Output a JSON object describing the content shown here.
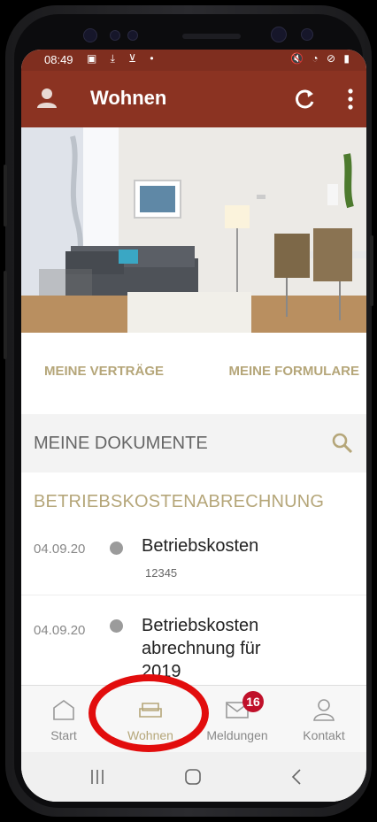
{
  "status_bar": {
    "time": "08:49",
    "left_icons": "▣ ⤓ ⊻ •",
    "right_icons": "🔇 ◔ ⊘ ▮"
  },
  "app_bar": {
    "title": "Wohnen",
    "icons": [
      "user-icon",
      "refresh-icon",
      "more-vert-icon"
    ]
  },
  "tabs": [
    {
      "label": "MEINE VERTRÄGE"
    },
    {
      "label": "MEINE FORMULARE"
    }
  ],
  "documents_header": {
    "label": "MEINE DOKUMENTE",
    "icon": "search-icon"
  },
  "category": "BETRIEBSKOSTENABRECHNUNG",
  "documents": [
    {
      "date": "04.09.20",
      "title": "Betriebskosten",
      "subtitle": "12345"
    },
    {
      "date": "04.09.20",
      "title": "Betriebskosten abrechnung für 2019",
      "subtitle": ""
    }
  ],
  "bottom_nav": [
    {
      "label": "Start",
      "icon": "home-outline-icon",
      "active": false
    },
    {
      "label": "Wohnen",
      "icon": "sofa-icon",
      "active": true
    },
    {
      "label": "Meldungen",
      "icon": "mail-icon",
      "active": false,
      "badge": "16"
    },
    {
      "label": "Kontakt",
      "icon": "person-icon",
      "active": false
    }
  ],
  "colors": {
    "app_bar": "#8b3322",
    "status_bar": "#7f2e1f",
    "accent_gold": "#b5a679",
    "badge_red": "#c0102a",
    "highlight": "#e20d0d"
  }
}
